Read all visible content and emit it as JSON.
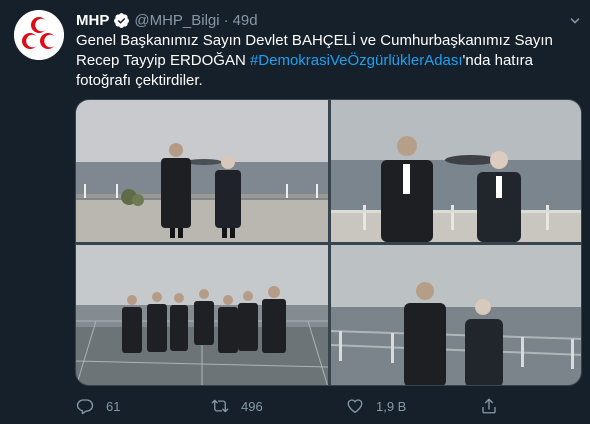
{
  "tweet": {
    "display_name": "MHP",
    "handle": "@MHP_Bilgi",
    "separator": "·",
    "time": "49d",
    "text_parts": [
      "Genel Başkanımız Sayın Devlet BAHÇELİ ve Cumhurbaşkanımız Sayın Recep Tayyip ERDOĞAN ",
      "#DemokrasiVeÖzgürlüklerAdası",
      "'nda hatıra fotoğrafı çektirdiler."
    ],
    "photos": [
      {
        "icon": "photo-two-leaders-terrace-island"
      },
      {
        "icon": "photo-two-leaders-sea-closeup"
      },
      {
        "icon": "photo-group-glass-platform"
      },
      {
        "icon": "photo-two-leaders-glass-railing"
      }
    ]
  },
  "actions": {
    "reply_count": "61",
    "retweet_count": "496",
    "like_count": "1,9 B",
    "share_icon": "share-icon"
  },
  "colors": {
    "background": "#15202b",
    "text": "#ffffff",
    "muted": "#8899a6",
    "link": "#1da1f2",
    "border": "#38444d",
    "logo_red": "#e30a17"
  }
}
